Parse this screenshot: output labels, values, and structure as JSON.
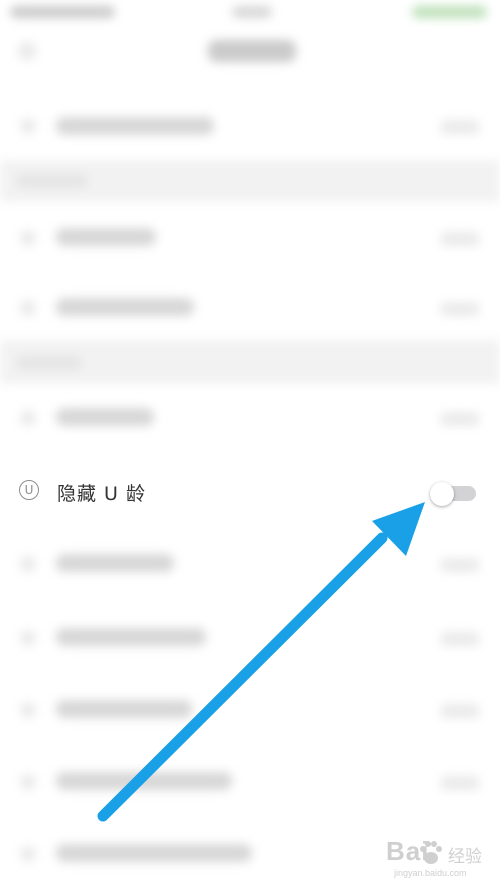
{
  "setting_row": {
    "icon": "u-circle-icon",
    "icon_glyph": "U",
    "label": "隐藏 U 龄",
    "toggle_on": false
  },
  "annotation": {
    "arrow_color": "#1aa0e6"
  },
  "watermark": {
    "brand": "Bai",
    "text": "经验",
    "url": "jingyan.baidu.com"
  }
}
